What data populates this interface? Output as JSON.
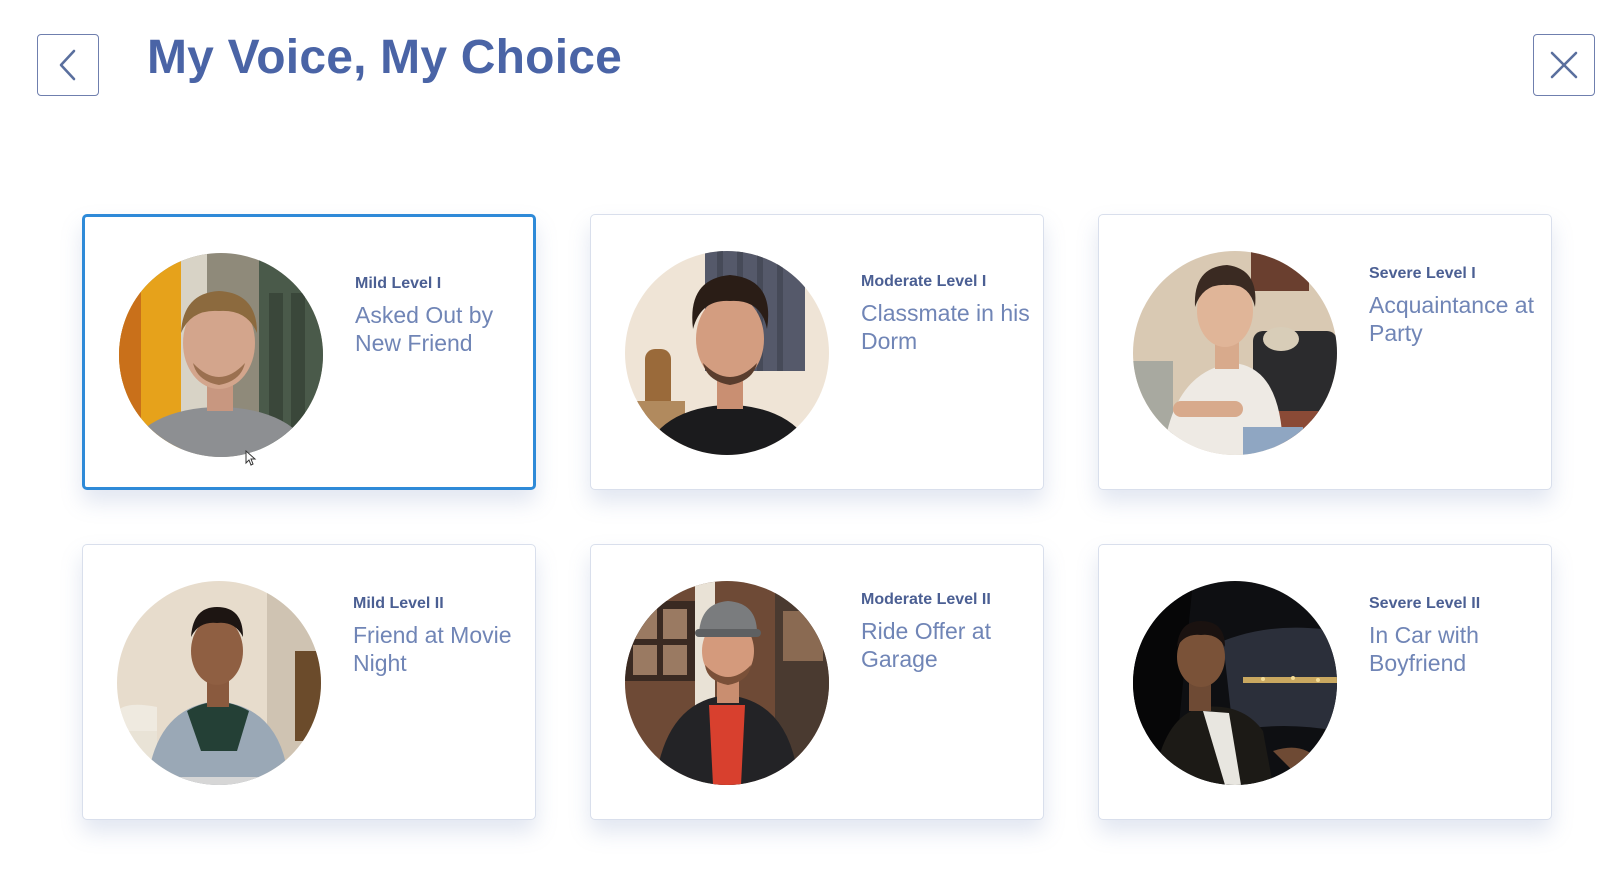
{
  "header": {
    "title": "My Voice, My Choice",
    "back_icon": "chevron-left-icon",
    "close_icon": "close-icon",
    "accent_color": "#4a64a6"
  },
  "scenarios": [
    {
      "level": "Mild Level I",
      "title": "Asked Out by New Friend",
      "selected": true,
      "photo": "young-man-school-hallway"
    },
    {
      "level": "Moderate Level I",
      "title": "Classmate in his Dorm",
      "selected": false,
      "photo": "young-man-dorm-room"
    },
    {
      "level": "Severe Level I",
      "title": "Acquaintance at Party",
      "selected": false,
      "photo": "young-man-on-couch"
    },
    {
      "level": "Mild Level II",
      "title": "Friend at Movie Night",
      "selected": false,
      "photo": "young-man-in-wicker-chair"
    },
    {
      "level": "Moderate Level II",
      "title": "Ride Offer at Garage",
      "selected": false,
      "photo": "young-man-in-cap-at-garage"
    },
    {
      "level": "Severe Level II",
      "title": "In Car with Boyfriend",
      "selected": false,
      "photo": "young-man-in-car-at-night"
    }
  ],
  "colors": {
    "selected_border": "#2e8ad8",
    "level_text": "#4b5f93",
    "scenario_text": "#7085b6"
  }
}
